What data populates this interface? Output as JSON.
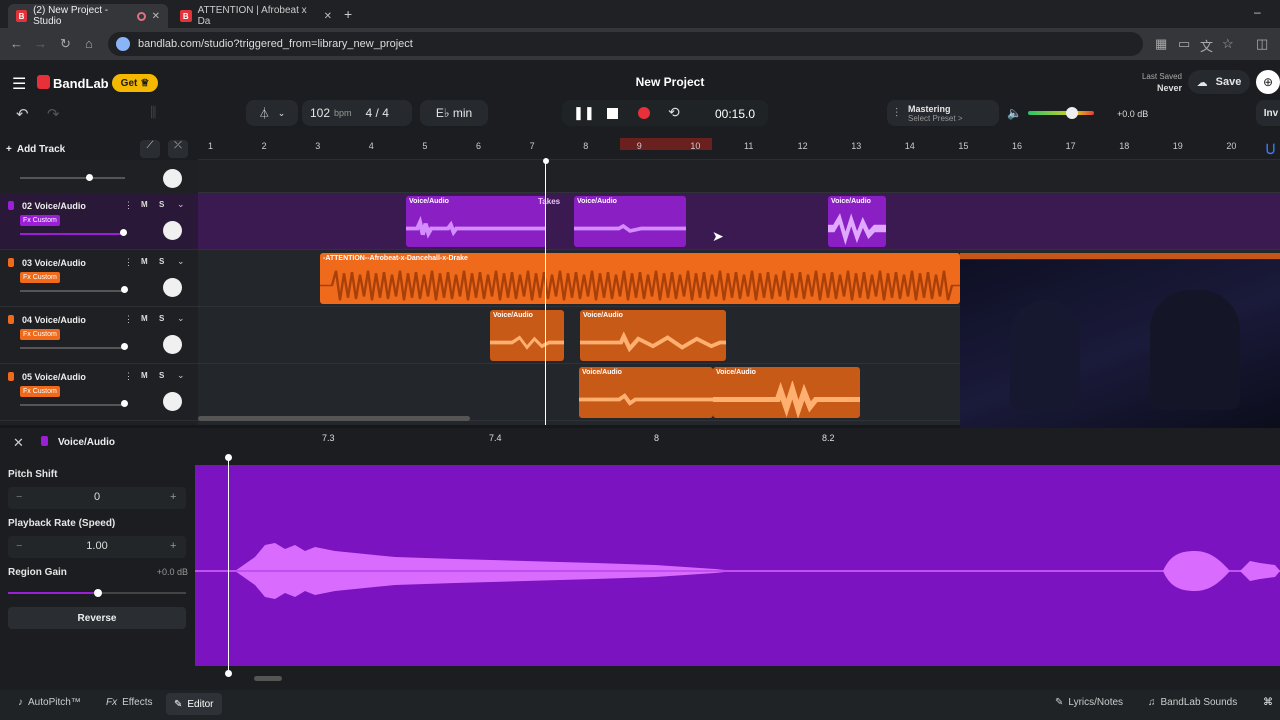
{
  "browser": {
    "tabs": [
      {
        "title": "(2) New Project - Studio",
        "favicon": "B",
        "active": true
      },
      {
        "title": "ATTENTION | Afrobeat x Da",
        "favicon": "B",
        "active": false
      }
    ],
    "new_tab": "+",
    "url": "bandlab.com/studio?triggered_from=library_new_project",
    "window_controls": [
      "–",
      "□",
      "✕"
    ]
  },
  "app": {
    "brand": "BandLab",
    "get_button": "Get",
    "project_title": "New Project",
    "last_saved_label": "Last Saved",
    "last_saved_value": "Never",
    "save_button": "Save",
    "invite_button": "Inv"
  },
  "transport": {
    "tempo_value": "102",
    "tempo_unit": "bpm",
    "time_signature": "4 / 4",
    "key": "E♭ min",
    "time": "00:15.0",
    "mastering_label": "Mastering",
    "mastering_preset": "Select Preset >",
    "volume_db": "+0.0 dB"
  },
  "timeline": {
    "add_track": "Add Track",
    "ruler": [
      "1",
      "2",
      "3",
      "4",
      "5",
      "6",
      "7",
      "8",
      "9",
      "10",
      "11",
      "12",
      "13",
      "14",
      "15",
      "16",
      "17",
      "18",
      "19",
      "20"
    ],
    "loop_region": [
      "9",
      "10"
    ]
  },
  "tracks": [
    {
      "number": "02",
      "name": "Voice/Audio",
      "fx": "Fx Custom",
      "color": "#9b1fd6"
    },
    {
      "number": "03",
      "name": "Voice/Audio",
      "fx": "Fx Custom",
      "color": "#f06a1c"
    },
    {
      "number": "04",
      "name": "Voice/Audio",
      "fx": "Fx Custom",
      "color": "#f06a1c"
    },
    {
      "number": "05",
      "name": "Voice/Audio",
      "fx": "Fx Custom",
      "color": "#f06a1c"
    }
  ],
  "track_buttons": {
    "mute": "M",
    "solo": "S"
  },
  "clips": {
    "c1": "Voice/Audio",
    "c2": "Voice/Audio",
    "c3": "Voice/Audio",
    "takes": "Takes",
    "c4": "-ATTENTION--Afrobeat-x-Dancehall-x-Drake",
    "c5": "Voice/Audio",
    "c6": "Voice/Audio",
    "c7": "Voice/Audio",
    "c8": "Voice/Audio"
  },
  "editor": {
    "title": "Voice/Audio",
    "ruler": [
      "7.3",
      "7.4",
      "8",
      "8.2"
    ],
    "pitch_shift_label": "Pitch Shift",
    "pitch_shift_value": "0",
    "playback_rate_label": "Playback Rate (Speed)",
    "playback_rate_value": "1.00",
    "region_gain_label": "Region Gain",
    "region_gain_value": "+0.0 dB",
    "reverse_button": "Reverse",
    "minus": "−",
    "plus": "+"
  },
  "bottom": {
    "autopitch": "AutoPitch™",
    "effects": "Effects",
    "editor": "Editor",
    "lyrics": "Lyrics/Notes",
    "sounds": "BandLab Sounds"
  },
  "colors": {
    "purple": "#9b1fd6",
    "orange": "#f06a1c",
    "record": "#e8303a",
    "get_yellow": "#f5b800"
  }
}
